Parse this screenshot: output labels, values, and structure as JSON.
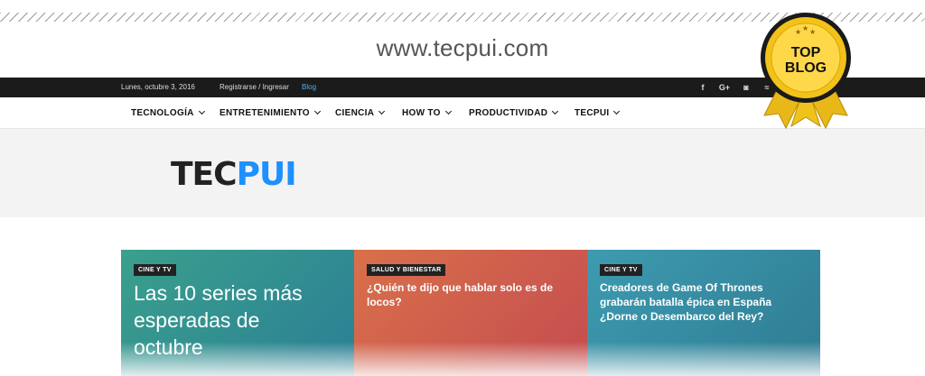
{
  "url": "www.tecpui.com",
  "topbar": {
    "date": "Lunes, octubre 3, 2016",
    "register": "Registrarse / Ingresar",
    "blog": "Blog",
    "social": [
      {
        "icon": "facebook-icon",
        "glyph": "f"
      },
      {
        "icon": "google-plus-icon",
        "glyph": "G+"
      },
      {
        "icon": "instagram-icon",
        "glyph": "◙"
      },
      {
        "icon": "rss-icon",
        "glyph": "≈"
      }
    ]
  },
  "nav": {
    "items": [
      {
        "label": "TECNOLOGÍA"
      },
      {
        "label": "ENTRETENIMIENTO"
      },
      {
        "label": "CIENCIA"
      },
      {
        "label": "HOW TO"
      },
      {
        "label": "PRODUCTIVIDAD"
      },
      {
        "label": "TECPUI"
      }
    ]
  },
  "logo": {
    "part1": "TEC",
    "part2": "PUI"
  },
  "badge": {
    "line1": "TOP",
    "line2": "BLOG"
  },
  "cards": [
    {
      "tag": "CINE Y TV",
      "title": "Las 10 series más esperadas de octubre",
      "color": "#2f8f86"
    },
    {
      "tag": "SALUD Y BIENESTAR",
      "title": "¿Quién te dijo que hablar solo es de locos?",
      "color": "#cf5a4a"
    },
    {
      "tag": "CINE Y TV",
      "title": "Creadores de Game Of Thrones grabarán batalla épica en España ¿Dorne o Desembarco del Rey?",
      "color": "#3f8fa8"
    }
  ],
  "colors": {
    "topbar": "#1b1b1b",
    "link": "#4db2ec",
    "logo_accent": "#1e90ff",
    "badge_gold": "#f2c21b"
  }
}
